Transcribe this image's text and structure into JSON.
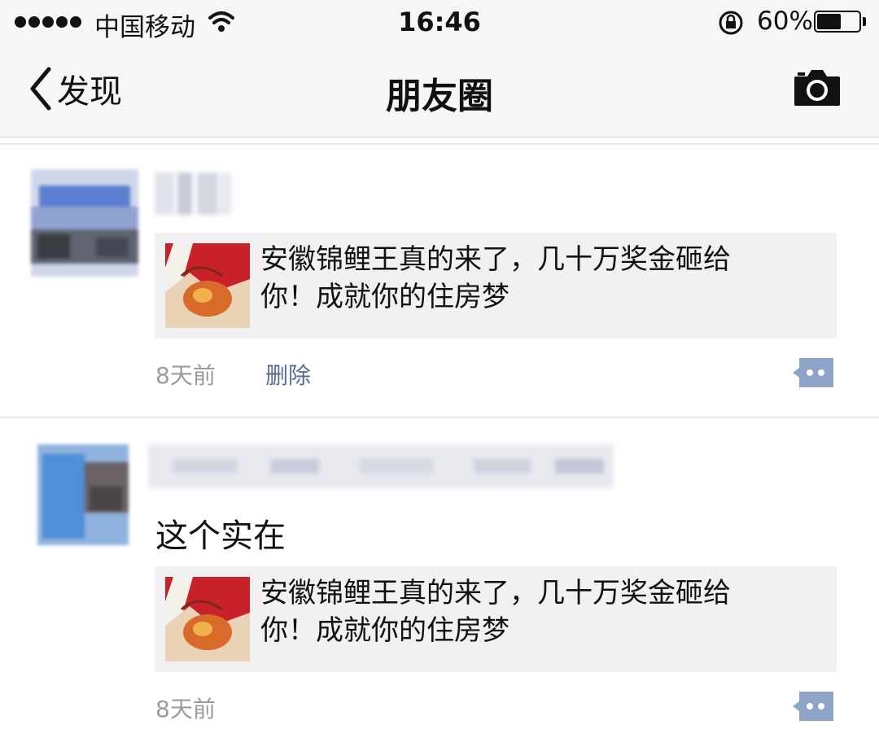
{
  "status_bar": {
    "carrier": "中国移动",
    "time": "16:46",
    "battery_text": "60%",
    "battery_level": 0.6,
    "icons": [
      "signal-dots-icon",
      "wifi-icon",
      "rotation-lock-icon",
      "battery-icon"
    ]
  },
  "nav": {
    "back_label": "发现",
    "title": "朋友圈",
    "back_icon": "chevron-left-icon",
    "camera_icon": "camera-icon"
  },
  "posts": [
    {
      "text": "",
      "link_title": "安徽锦鲤王真的来了，几十万奖金砸给\n你！成就你的住房梦",
      "time": "8天前",
      "delete_label": "删除"
    },
    {
      "text": "这个实在",
      "link_title": "安徽锦鲤王真的来了，几十万奖金砸给\n你！成就你的住房梦",
      "time": "8天前"
    }
  ],
  "colors": {
    "bar_bg": "#f6f6f7",
    "link_card_bg": "#f1f1f3",
    "meta_gray": "#9b9b9b",
    "link_blue": "#5a6b93",
    "comment_icon": "#8fa5c8",
    "thumb_red": "#c8212a"
  }
}
